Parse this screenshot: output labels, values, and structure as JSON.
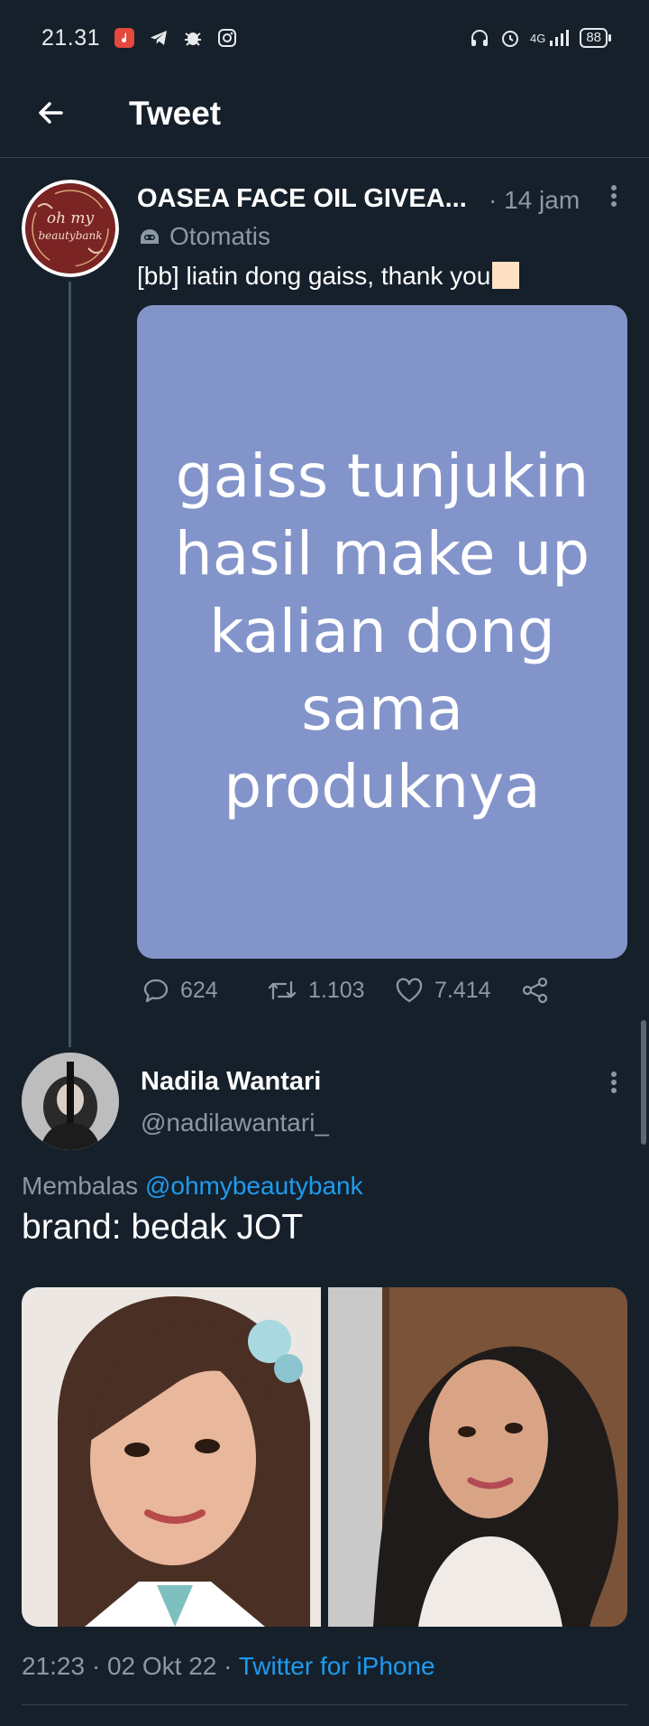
{
  "status_bar": {
    "time": "21.31",
    "network": "4G",
    "battery": "88",
    "icons": [
      "music-app-icon",
      "telegram-icon",
      "bug-icon",
      "instagram-icon",
      "headphones-icon",
      "alarm-icon",
      "signal-icon"
    ]
  },
  "header": {
    "title": "Tweet",
    "back_icon": "arrow-left-icon"
  },
  "tweet_main": {
    "avatar_logo_text": "oh my beautybank",
    "author_name": "OASEA FACE OIL GIVEA...",
    "time_ago": "· 14 jam",
    "automated_label": "Otomatis",
    "text": "[bb] liatin dong gaiss, thank you",
    "emoji_glyph": "",
    "media_text": "gaiss tunjukin hasil make up kalian dong sama produknya",
    "colors": {
      "media_bg": "#8394ca",
      "emoji_box": "#fde1c2"
    },
    "actions": {
      "replies": "624",
      "retweets": "1.103",
      "likes": "7.414"
    }
  },
  "tweet_reply": {
    "author_name": "Nadila Wantari",
    "handle": "@nadilawantari_",
    "replying_prefix": "Membalas",
    "replying_to": "@ohmybeautybank",
    "text": "brand: bedak JOT",
    "timestamp": "21:23 · 02 Okt 22 ·",
    "source": "Twitter for iPhone"
  },
  "theme": {
    "background": "#15202b",
    "secondary_text": "#8b98a5",
    "accent": "#1d9bf0",
    "divider": "#38444d"
  }
}
